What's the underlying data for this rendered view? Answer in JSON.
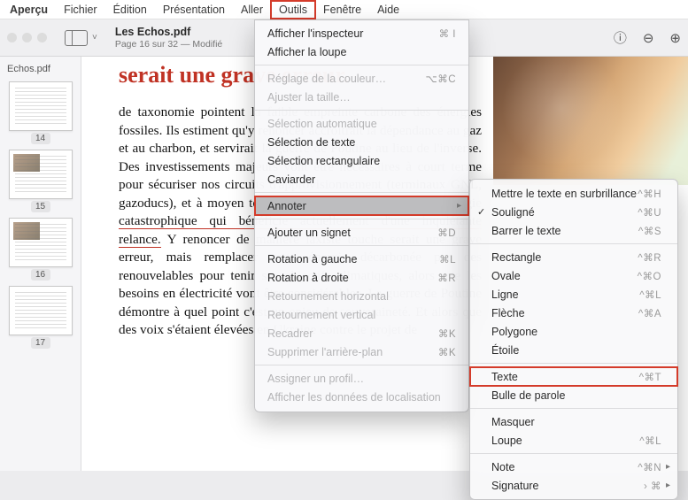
{
  "menubar": {
    "items": [
      {
        "label": "Aperçu"
      },
      {
        "label": "Fichier"
      },
      {
        "label": "Édition"
      },
      {
        "label": "Présentation"
      },
      {
        "label": "Aller"
      },
      {
        "label": "Outils",
        "active": true
      },
      {
        "label": "Fenêtre"
      },
      {
        "label": "Aide"
      }
    ]
  },
  "toolbar": {
    "doc_title": "Les Echos.pdf",
    "doc_subtitle": "Page 16 sur 32 — Modifié"
  },
  "thumbs": {
    "filename": "Echos.pdf",
    "pages": [
      "14",
      "15",
      "16",
      "17"
    ]
  },
  "article": {
    "title": "serait une  grave erreur.",
    "body_pre": "de taxonomie pointent la faible empreinte carbone des énergies fossiles. Ils estiment qu'y renoncer accroîtrait la dépendance au gaz et au charbon, et servirait la guerre de Poutine au lieu de l'inverse. Des investissements majeurs vont être nécessaires à court terme pour sécuriser nos circuits d'approvisionnement (terminaux GNL, gazoducs), et à moyen terme pour sortir du charbon, une énergie ",
    "body_red": "catastrophique qui bénéficie actuellement d'une inquiétante relance.",
    "body_post": " Y renoncer de manière laxiste touche serait une grave erreur, mais remplacer cette énergie décarbonée par des renouvelables pour tenir ses objectifs climatiques, alors que les besoins en électricité vont être considérables. La guerre de Poutine démontre à quel point c'est un enjeu de souveraineté. Et alors que des voix s'étaient élevées en Ukraine contre le projet de"
  },
  "tools_menu": {
    "items": [
      {
        "label": "Afficher l'inspecteur",
        "shortcut": "⌘ I"
      },
      {
        "label": "Afficher la loupe"
      },
      {
        "sep": true
      },
      {
        "label": "Réglage de la couleur…",
        "shortcut": "⌥⌘C",
        "disabled": true
      },
      {
        "label": "Ajuster la taille…",
        "disabled": true
      },
      {
        "sep": true
      },
      {
        "label": "Sélection automatique",
        "disabled": true
      },
      {
        "label": "Sélection de texte"
      },
      {
        "label": "Sélection rectangulaire"
      },
      {
        "label": "Caviarder"
      },
      {
        "sep": true
      },
      {
        "label": "Annoter",
        "submenu": true,
        "highlight": true
      },
      {
        "sep": true
      },
      {
        "label": "Ajouter un signet",
        "shortcut": "⌘D"
      },
      {
        "sep": true
      },
      {
        "label": "Rotation à gauche",
        "shortcut": "⌘L"
      },
      {
        "label": "Rotation à droite",
        "shortcut": "⌘R"
      },
      {
        "label": "Retournement horizontal",
        "disabled": true
      },
      {
        "label": "Retournement vertical",
        "disabled": true
      },
      {
        "label": "Recadrer",
        "shortcut": "⌘K",
        "disabled": true
      },
      {
        "label": "Supprimer l'arrière-plan",
        "shortcut": "⌘K",
        "disabled": true
      },
      {
        "sep": true
      },
      {
        "label": "Assigner un profil…",
        "disabled": true
      },
      {
        "label": "Afficher les données de localisation",
        "disabled": true
      }
    ]
  },
  "annoter_submenu": {
    "items": [
      {
        "label": "Mettre le texte en surbrillance",
        "shortcut": "^⌘H"
      },
      {
        "label": "Souligné",
        "shortcut": "^⌘U",
        "checked": true
      },
      {
        "label": "Barrer le texte",
        "shortcut": "^⌘S"
      },
      {
        "sep": true
      },
      {
        "label": "Rectangle",
        "shortcut": "^⌘R"
      },
      {
        "label": "Ovale",
        "shortcut": "^⌘O"
      },
      {
        "label": "Ligne",
        "shortcut": "^⌘L"
      },
      {
        "label": "Flèche",
        "shortcut": "^⌘A"
      },
      {
        "label": "Polygone"
      },
      {
        "label": "Étoile"
      },
      {
        "sep": true
      },
      {
        "label": "Texte",
        "shortcut": "^⌘T",
        "boxed": true
      },
      {
        "label": "Bulle de parole"
      },
      {
        "sep": true
      },
      {
        "label": "Masquer"
      },
      {
        "label": "Loupe",
        "shortcut": "^⌘L"
      },
      {
        "sep": true
      },
      {
        "label": "Note",
        "shortcut": "^⌘N",
        "submenu": true
      },
      {
        "label": "Signature",
        "shortcut": "› ⌘",
        "submenu": true
      }
    ]
  }
}
